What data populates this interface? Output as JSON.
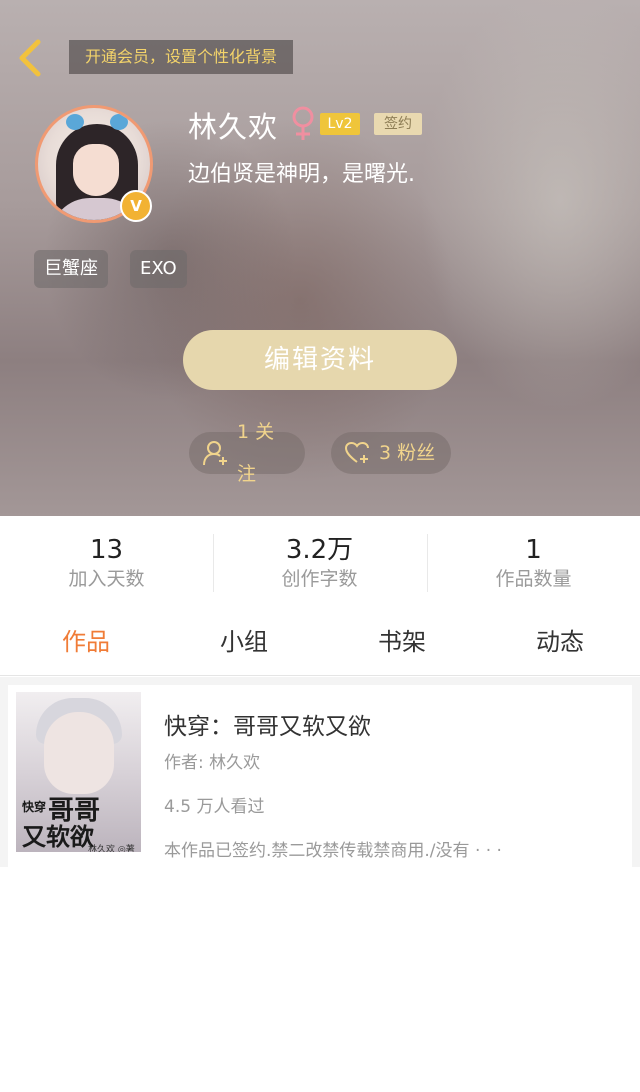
{
  "header": {
    "vip_banner": "开通会员，设置个性化背景",
    "user_name": "林久欢",
    "level": "Lv2",
    "signed_label": "签约",
    "bio": "边伯贤是神明，是曙光.",
    "badge_letter": "V",
    "tags": [
      "巨蟹座",
      "EXO"
    ],
    "edit_button": "编辑资料",
    "follow_label": "1 关注",
    "fans_label": "3 粉丝",
    "colors": {
      "accent_gold": "#f1d48c",
      "level_badge": "#efc53a",
      "avatar_border": "#f09a73"
    }
  },
  "stats": [
    {
      "value": "13",
      "label": "加入天数"
    },
    {
      "value": "3.2万",
      "label": "创作字数"
    },
    {
      "value": "1",
      "label": "作品数量"
    }
  ],
  "tabs": [
    {
      "label": "作品",
      "active": true
    },
    {
      "label": "小组",
      "active": false
    },
    {
      "label": "书架",
      "active": false
    },
    {
      "label": "动态",
      "active": false
    }
  ],
  "works": [
    {
      "title": "快穿：哥哥又软又欲",
      "author": "作者: 林久欢",
      "views": "4.5 万人看过",
      "description": "本作品已签约.禁二改禁传载禁商用./没有 · · ·",
      "cover": {
        "line1": "快穿",
        "line2": "哥哥",
        "line3": "又软欲",
        "author": "林久欢 ◎著"
      }
    }
  ],
  "icons": {
    "back": "chevron-left-icon",
    "gender": "female-icon",
    "follow": "add-user-icon",
    "fans": "heart-plus-icon"
  },
  "active_tab_color": "#f07c37"
}
